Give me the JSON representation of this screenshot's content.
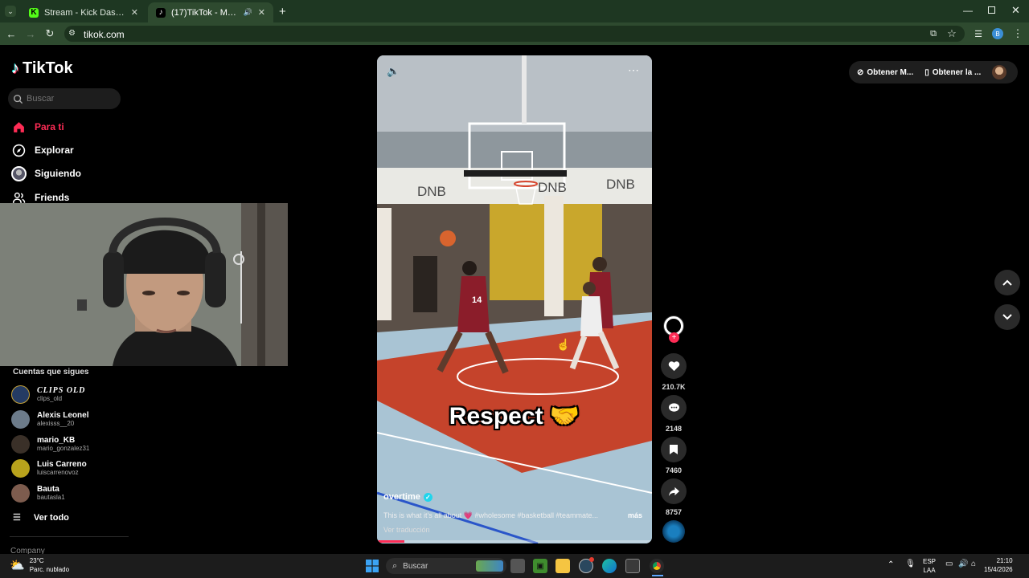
{
  "browser": {
    "tabs": [
      {
        "title": "Stream - Kick Dashboard",
        "active": false
      },
      {
        "title": "(17)TikTok - Make Your Day",
        "active": true
      }
    ],
    "url": "tikok.com"
  },
  "tiktok": {
    "logo": "TikTok",
    "search_placeholder": "Buscar",
    "nav": [
      {
        "label": "Para ti",
        "icon": "home-icon",
        "active": true
      },
      {
        "label": "Explorar",
        "icon": "compass-icon"
      },
      {
        "label": "Siguiendo",
        "icon": "following-avatar-icon"
      },
      {
        "label": "Friends",
        "icon": "friends-icon"
      }
    ],
    "following_header": "Cuentas que sigues",
    "following": [
      {
        "name": "CLIPS OLD",
        "handle": "clips_old",
        "color": "#243b63"
      },
      {
        "name": "Alexis Leonel",
        "handle": "alexisss__20",
        "color": "#6c7b8a"
      },
      {
        "name": "mario_KB",
        "handle": "mario_gonzalez31",
        "color": "#3a3028"
      },
      {
        "name": "Luis Carreno",
        "handle": "luiscarrenovoz",
        "color": "#b8a21c"
      },
      {
        "name": "Bauta",
        "handle": "bautasla1",
        "color": "#7d5c4e"
      }
    ],
    "view_all": "Ver todo",
    "company": "Company",
    "top_right": {
      "get_app_1": "Obtener M...",
      "get_app_2": "Obtener la ..."
    }
  },
  "video": {
    "overlay_text": "Respect 🤝",
    "author": "overtime",
    "caption": "This is what it's all about 💗 #wholesome #basketball #teammate...",
    "more": "más",
    "translate": "Ver traducción",
    "progress": 0.1,
    "banner_text": "DNB",
    "jersey_number": "14"
  },
  "actions": {
    "likes": "210.7K",
    "comments": "2148",
    "saves": "7460",
    "shares": "8757"
  },
  "taskbar": {
    "weather_temp": "23°C",
    "weather_desc": "Parc. nublado",
    "search": "Buscar",
    "lang_1": "ESP",
    "lang_2": "LAA",
    "time": "21:10",
    "date": "15/4/2026"
  },
  "colors": {
    "accent": "#fe2c55",
    "chrome": "#2e4a2f"
  }
}
